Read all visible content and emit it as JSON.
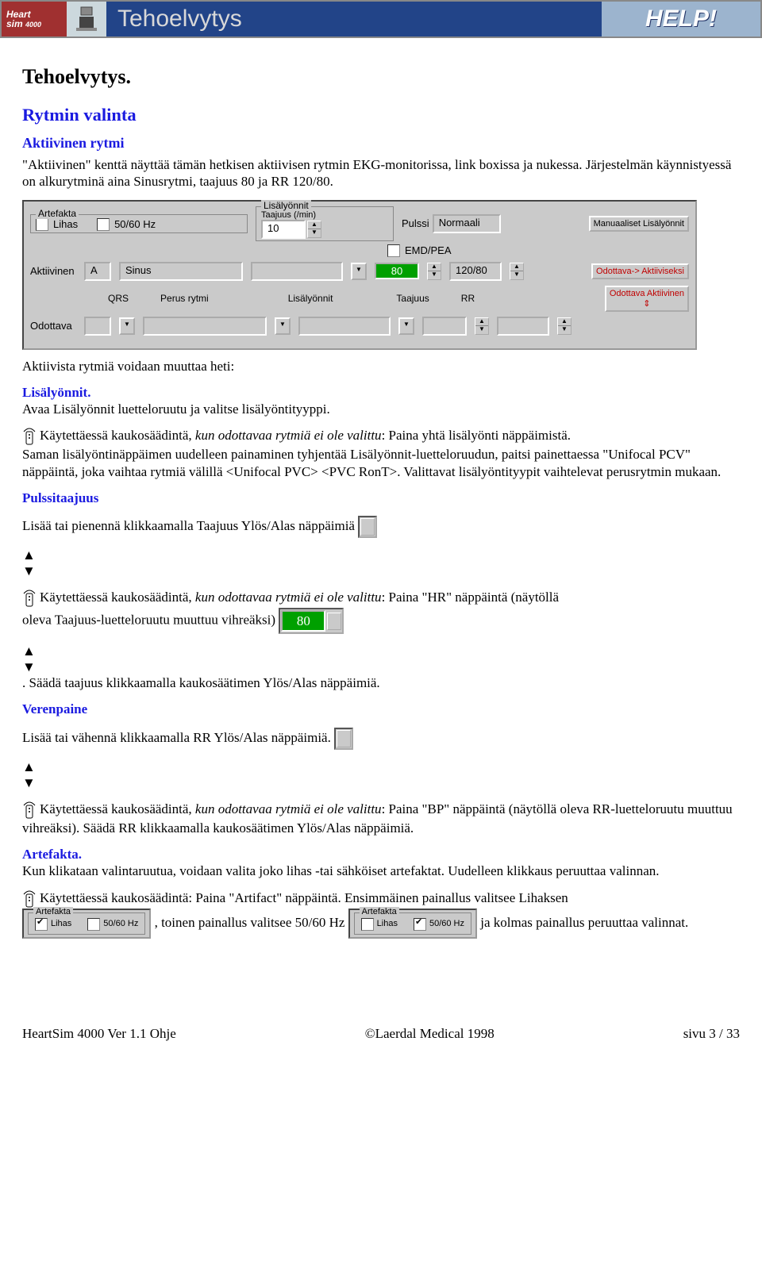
{
  "header": {
    "logo_line1": "Heart",
    "logo_line2": "sim",
    "logo_small": "4000",
    "title": "Tehoelvytys",
    "help": "HELP!"
  },
  "headings": {
    "h1": "Tehoelvytys.",
    "rytmin_valinta": "Rytmin valinta",
    "aktiivinen_rytmi": "Aktiivinen rytmi",
    "lisalyonnit": "Lisälyönnit.",
    "pulssitaajuus": "Pulssitaajuus",
    "verenpaine": "Verenpaine",
    "artefakta": "Artefakta."
  },
  "p": {
    "intro1": "\"Aktiivinen\" kenttä näyttää tämän hetkisen aktiivisen rytmin EKG-monitorissa, link boxissa ja nukessa. Järjestelmän käynnistyessä on alkurytminä aina Sinusrytmi, taajuus 80 ja RR 120/80.",
    "aktiivista_heti": "Aktiivista rytmiä voidaan muuttaa heti:",
    "lisalyonnit_avaa": "Avaa Lisälyönnit luetteloruutu ja valitse lisälyöntityyppi.",
    "remote1_a": "Käytettäessä kaukosäädintä, ",
    "remote1_b": "kun odottavaa rytmiä ei ole valittu",
    "remote1_c": ": Paina yhtä lisälyönti näppäimistä.",
    "saman_lisa": "Saman lisälyöntinäppäimen uudelleen painaminen tyhjentää Lisälyönnit-luetteloruudun, paitsi painettaessa \"Unifocal PCV\" näppäintä, joka vaihtaa rytmiä välillä <Unifocal PVC> <PVC RonT>. Valittavat lisälyöntityypit vaihtelevat perusrytmin mukaan.",
    "pulssi_lisaa": "Lisää tai pienennä klikkaamalla Taajuus Ylös/Alas näppäimiä",
    "remote2_a": "Käytettäessä kaukosäädintä, ",
    "remote2_b": "kun odottavaa rytmiä ei ole valittu",
    "remote2_c": ": Paina \"HR\" näppäintä (näytöllä",
    "remote2_d": "oleva Taajuus-luetteloruutu muuttuu vihreäksi) ",
    "remote2_e": ". Säädä taajuus klikkaamalla kaukosäätimen Ylös/Alas näppäimiä.",
    "rr_lisaa": "Lisää tai vähennä klikkaamalla RR Ylös/Alas näppäimiä.",
    "remote3_a": "Käytettäessä kaukosäädintä, ",
    "remote3_b": "kun odottavaa rytmiä ei ole valittu",
    "remote3_c": ": Paina \"BP\" näppäintä (näytöllä oleva RR-luetteloruutu muuttuu vihreäksi). Säädä RR klikkaamalla kaukosäätimen Ylös/Alas näppäimiä.",
    "artefakta_body": "Kun klikataan valintaruutua, voidaan valita joko lihas -tai sähköiset artefaktat. Uudelleen klikkaus peruuttaa valinnan.",
    "remote4_a": "Käytettäessä kaukosäädintä: Paina \"Artifact\" näppäintä. Ensimmäinen painallus valitsee Lihaksen",
    "remote4_b": ", toinen painallus valitsee 50/60 Hz ",
    "remote4_c": "ja kolmas painallus peruuttaa valinnat."
  },
  "panel": {
    "artefakta_legend": "Artefakta",
    "lihas": "Lihas",
    "hz": "50/60 Hz",
    "lisalyonnit_legend": "Lisälyönnit",
    "taajuus_per_min": "Taajuus (/min)",
    "taajuus_val": "10",
    "pulssi": "Pulssi",
    "pulssi_val": "Normaali",
    "emd": "EMD/PEA",
    "manual": "Manuaaliset Lisälyönnit",
    "aktiivinen": "Aktiivinen",
    "akt_a": "A",
    "akt_sinus": "Sinus",
    "hr_val": "80",
    "rr_val": "120/80",
    "odottava_akt": "Odottava-> Aktiiviseksi",
    "qrs": "QRS",
    "perus": "Perus rytmi",
    "lisalyonnit2": "Lisälyönnit",
    "taajuus2": "Taajuus",
    "rr2": "RR",
    "odottava_akt2": "Odottava Aktiivinen",
    "odottava": "Odottava"
  },
  "inline": {
    "green80": "80",
    "mini1_legend": "Artefakta",
    "mini1_lihas": "Lihas",
    "mini1_hz": "50/60 Hz",
    "mini2_legend": "Artefakta",
    "mini2_lihas": "Lihas",
    "mini2_hz": "50/60 Hz"
  },
  "footer": {
    "left": "HeartSim 4000 Ver 1.1 Ohje",
    "center": "©Laerdal Medical 1998",
    "right": "sivu 3 / 33"
  }
}
